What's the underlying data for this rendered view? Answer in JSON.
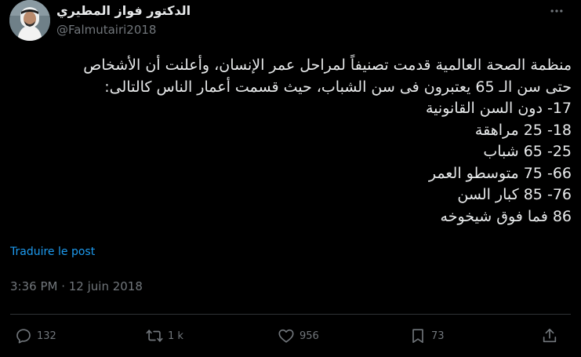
{
  "author": {
    "display_name": "الدكتور فواز المطيري",
    "handle": "@Falmutairi2018"
  },
  "tweet": {
    "text": "منظمة الصحة العالمية قدمت تصنيفاً لمراحل عمر الإنسان، وأعلنت أن الأشخاص\nحتى سن الـ 65 يعتبرون فى سن الشباب، حيث قسمت أعمار الناس كالتالى:\n17- دون السن القانونية\n18- 25 مراهقة\n25- 65 شباب\n66- 75 متوسطو العمر\n76- 85 كبار السن\n86 فما فوق شيخوخه",
    "translate_label": "Traduire le post",
    "timestamp": "3:36 PM · 12 juin 2018"
  },
  "actions": {
    "reply_count": "132",
    "repost_count": "1 k",
    "like_count": "956",
    "bookmark_count": "73"
  },
  "icons": {
    "more": "more-horizontal-icon",
    "reply": "reply-icon",
    "repost": "repost-icon",
    "like": "heart-icon",
    "bookmark": "bookmark-icon",
    "share": "share-icon"
  },
  "colors": {
    "background": "#000000",
    "text_primary": "#e7e9ea",
    "text_secondary": "#71767b",
    "link": "#1d9bf0",
    "divider": "#2f3336"
  }
}
